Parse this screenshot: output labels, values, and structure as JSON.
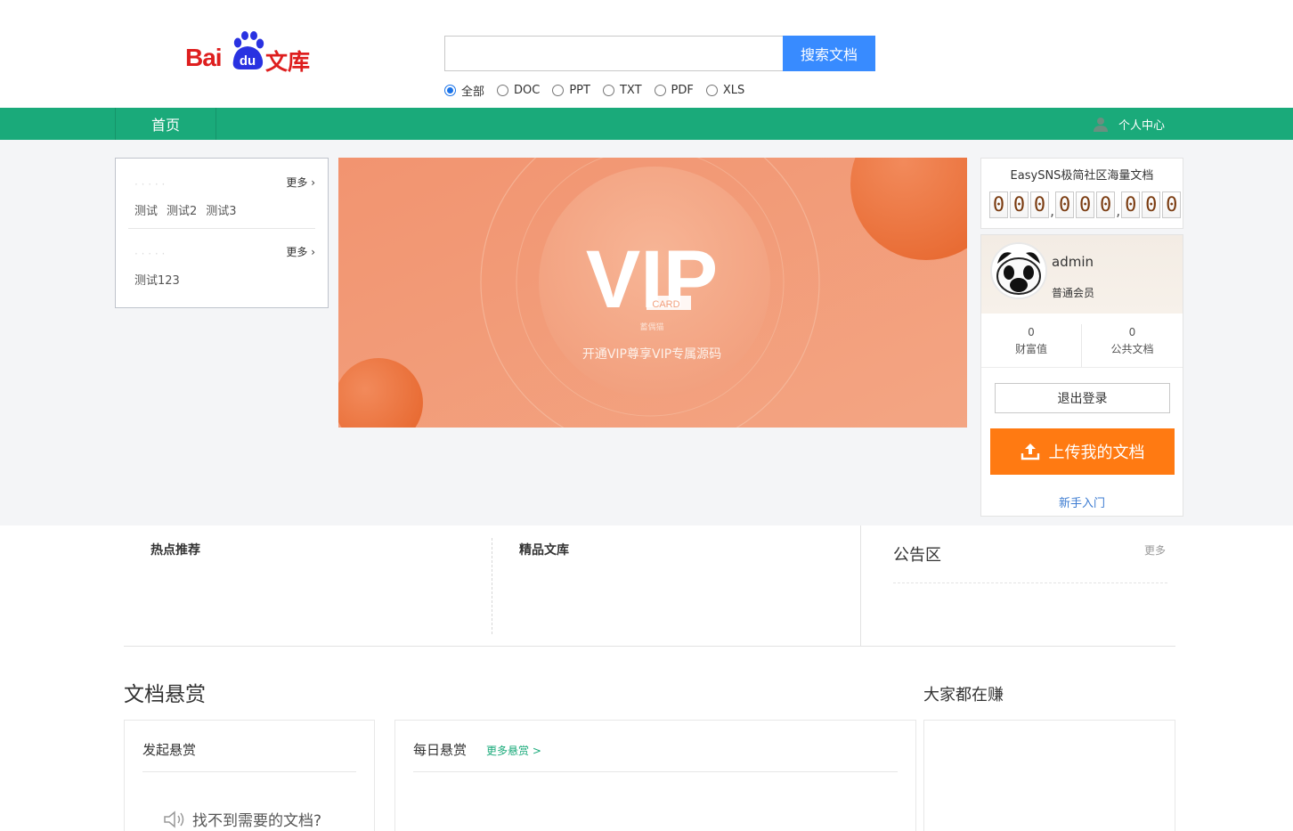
{
  "header": {
    "logo_bai": "Bai",
    "logo_du": "du",
    "logo_wenku": "文库",
    "search_placeholder": "",
    "search_button": "搜索文档",
    "filters": [
      {
        "label": "全部",
        "checked": true
      },
      {
        "label": "DOC",
        "checked": false
      },
      {
        "label": "PPT",
        "checked": false
      },
      {
        "label": "TXT",
        "checked": false
      },
      {
        "label": "PDF",
        "checked": false
      },
      {
        "label": "XLS",
        "checked": false
      }
    ]
  },
  "nav": {
    "home": "首页",
    "user_center": "个人中心",
    "bar_color": "#1aaa7a"
  },
  "categories": {
    "groups": [
      {
        "more": "更多 ›",
        "links": [
          "测试",
          "测试2",
          "测试3"
        ]
      },
      {
        "more": "更多 ›",
        "links": [
          "测试123"
        ]
      }
    ]
  },
  "banner": {
    "vip": "VIP",
    "card": "CARD",
    "small": "蓄偶猫",
    "tagline": "开通VIP尊享VIP专属源码"
  },
  "stats": {
    "title": "EasySNS极简社区海量文档",
    "counter": "000,000,000"
  },
  "user": {
    "name": "admin",
    "level": "普通会员",
    "wealth_value": "0",
    "wealth_label": "财富值",
    "docs_value": "0",
    "docs_label": "公共文档",
    "logout": "退出登录",
    "upload": "上传我的文档",
    "guide": "新手入门",
    "upload_color": "#ff7a12"
  },
  "middle": {
    "hot": "热点推荐",
    "fine": "精品文库",
    "notice": "公告区",
    "notice_more": "更多"
  },
  "bottom": {
    "reward_title": "文档悬赏",
    "earn_title": "大家都在赚",
    "launch_title": "发起悬赏",
    "not_found": "找不到需要的文档?",
    "daily_title": "每日悬赏",
    "daily_more": "更多悬赏 >"
  },
  "icons": [
    "paw-icon",
    "user-icon",
    "upload-icon",
    "speaker-icon"
  ]
}
